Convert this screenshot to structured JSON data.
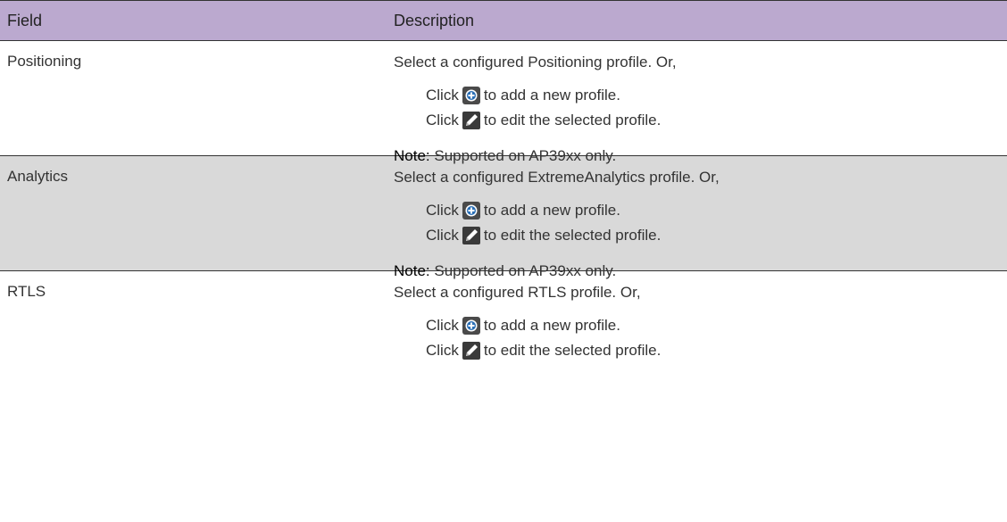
{
  "table": {
    "headers": {
      "field": "Field",
      "description": "Description"
    },
    "rows": [
      {
        "field": "Positioning",
        "intro": "Select a configured Positioning profile. Or,",
        "steps": [
          {
            "prefix": "Click",
            "icon": "add-circle-icon",
            "suffix": "to add a new profile."
          },
          {
            "prefix": "Click",
            "icon": "edit-pencil-icon",
            "suffix": "to edit the selected profile."
          }
        ],
        "note_label": "Note:",
        "note_text": "Supported on AP39xx only."
      },
      {
        "field": "Analytics",
        "intro": "Select a configured ExtremeAnalytics profile. Or,",
        "steps": [
          {
            "prefix": "Click",
            "icon": "add-circle-icon",
            "suffix": "to add a new profile."
          },
          {
            "prefix": "Click",
            "icon": "edit-pencil-icon",
            "suffix": "to edit the selected profile."
          }
        ],
        "note_label": "Note:",
        "note_text": "Supported on AP39xx only."
      },
      {
        "field": "RTLS",
        "intro": "Select a configured RTLS profile. Or,",
        "steps": [
          {
            "prefix": "Click",
            "icon": "add-circle-icon",
            "suffix": "to add a new profile."
          },
          {
            "prefix": "Click",
            "icon": "edit-pencil-icon",
            "suffix": "to edit the selected profile."
          }
        ]
      }
    ]
  },
  "colors": {
    "header_bg": "#bba9cf",
    "shaded_row_bg": "#d9d9d9",
    "border": "#333333"
  }
}
